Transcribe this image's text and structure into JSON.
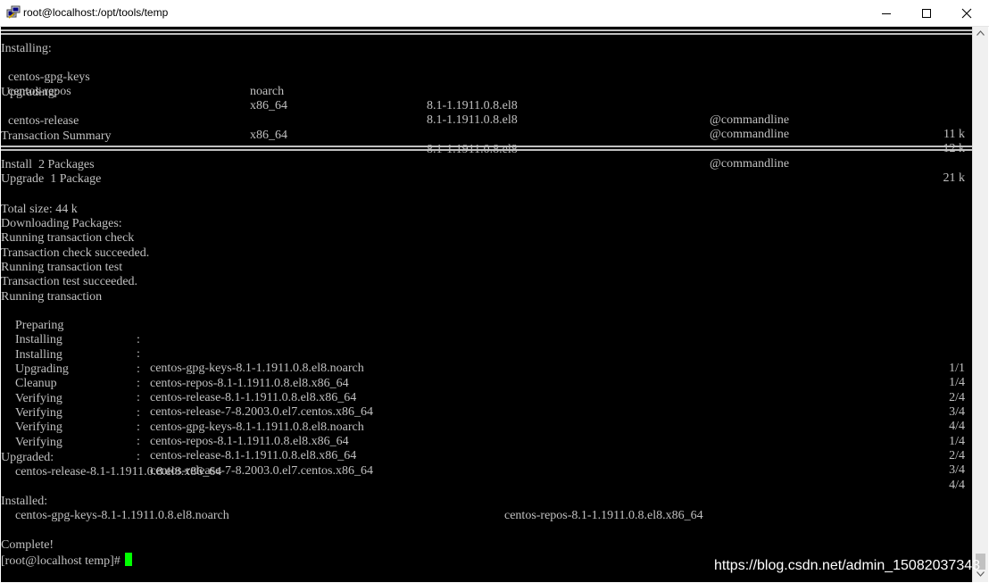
{
  "window": {
    "title": "root@localhost:/opt/tools/temp"
  },
  "icons": {
    "app": "putty-terminal-icon",
    "minimize": "minimize-icon",
    "maximize": "maximize-icon",
    "close": "close-icon"
  },
  "colors": {
    "terminal_bg": "#000000",
    "terminal_fg": "#c0c0c0",
    "cursor": "#00ff00"
  },
  "sections": {
    "installing_header": "Installing:",
    "upgrading_header": "Upgrading:",
    "transaction_summary": "Transaction Summary"
  },
  "packages": {
    "installing": [
      {
        "name": "centos-gpg-keys",
        "arch": "noarch",
        "version": "8.1-1.1911.0.8.el8",
        "repo": "@commandline",
        "size": "11 k"
      },
      {
        "name": "centos-repos",
        "arch": "x86_64",
        "version": "8.1-1.1911.0.8.el8",
        "repo": "@commandline",
        "size": "12 k"
      }
    ],
    "upgrading": [
      {
        "name": "centos-release",
        "arch": "x86_64",
        "version": "8.1-1.1911.0.8.el8",
        "repo": "@commandline",
        "size": "21 k"
      }
    ]
  },
  "summary": {
    "install": "Install  2 Packages",
    "upgrade": "Upgrade  1 Package"
  },
  "log": [
    "Total size: 44 k",
    "Downloading Packages:",
    "Running transaction check",
    "Transaction check succeeded.",
    "Running transaction test",
    "Transaction test succeeded.",
    "Running transaction"
  ],
  "steps": [
    {
      "action": "Preparing",
      "target": "",
      "progress": "1/1"
    },
    {
      "action": "Installing",
      "target": "centos-gpg-keys-8.1-1.1911.0.8.el8.noarch",
      "progress": "1/4"
    },
    {
      "action": "Installing",
      "target": "centos-repos-8.1-1.1911.0.8.el8.x86_64",
      "progress": "2/4"
    },
    {
      "action": "Upgrading",
      "target": "centos-release-8.1-1.1911.0.8.el8.x86_64",
      "progress": "3/4"
    },
    {
      "action": "Cleanup",
      "target": "centos-release-7-8.2003.0.el7.centos.x86_64",
      "progress": "4/4"
    },
    {
      "action": "Verifying",
      "target": "centos-gpg-keys-8.1-1.1911.0.8.el8.noarch",
      "progress": "1/4"
    },
    {
      "action": "Verifying",
      "target": "centos-repos-8.1-1.1911.0.8.el8.x86_64",
      "progress": "2/4"
    },
    {
      "action": "Verifying",
      "target": "centos-release-8.1-1.1911.0.8.el8.x86_64",
      "progress": "3/4"
    },
    {
      "action": "Verifying",
      "target": "centos-release-7-8.2003.0.el7.centos.x86_64",
      "progress": "4/4"
    }
  ],
  "result": {
    "upgraded_header": "Upgraded:",
    "upgraded": [
      "centos-release-8.1-1.1911.0.8.el8.x86_64"
    ],
    "installed_header": "Installed:",
    "installed": [
      "centos-gpg-keys-8.1-1.1911.0.8.el8.noarch",
      "centos-repos-8.1-1.1911.0.8.el8.x86_64"
    ],
    "complete": "Complete!",
    "prompt": "[root@localhost temp]# "
  },
  "watermark": "https://blog.csdn.net/admin_15082037343"
}
